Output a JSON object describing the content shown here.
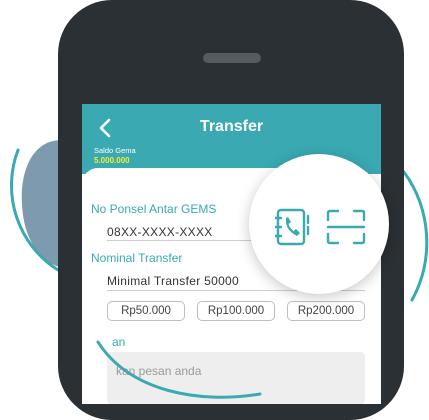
{
  "header": {
    "title": "Transfer",
    "balance_label": "Saldo Gema",
    "balance_value": "5.000.000"
  },
  "form": {
    "phone_label": "No Ponsel Antar GEMS",
    "phone_value": "08XX-XXXX-XXXX",
    "amount_label": "Nominal Transfer",
    "amount_value": "Minimal Transfer 50000",
    "quick_amounts": [
      "Rp50.000",
      "Rp100.000",
      "Rp200.000"
    ],
    "message_label_partial": "an",
    "message_placeholder_partial": "kan pesan anda"
  },
  "icons": {
    "back": "chevron-left-icon",
    "contacts": "contact-book-icon",
    "scan": "scan-frame-icon"
  },
  "colors": {
    "accent": "#3aa9b2",
    "balance": "#f7ec2f",
    "phone_body": "#2b3034",
    "deco_blob": "#7d9aae"
  }
}
